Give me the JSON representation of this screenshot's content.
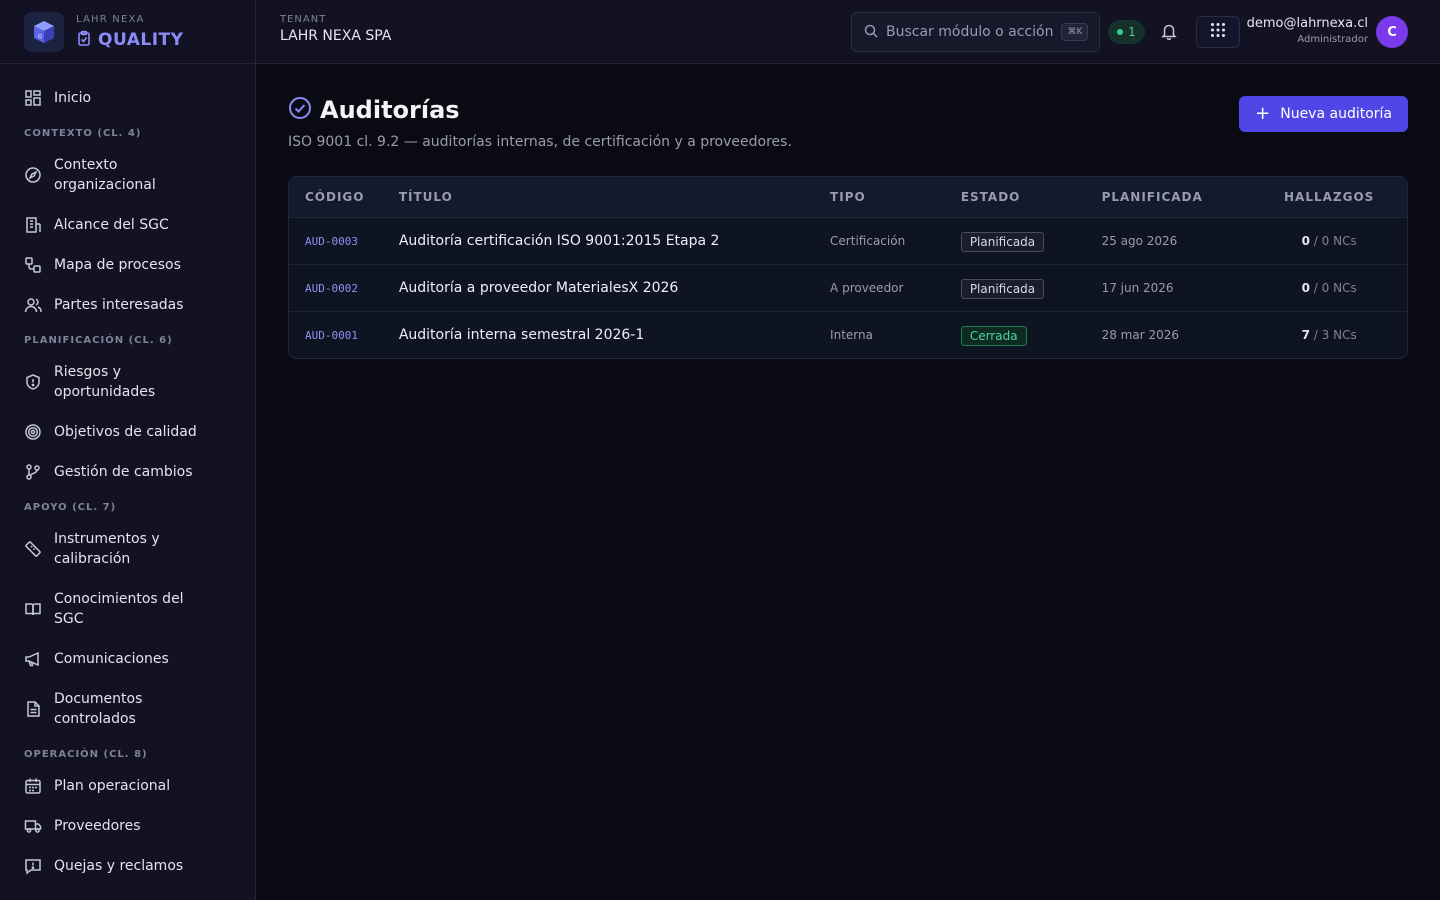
{
  "brand": {
    "small": "LAHR NEXA",
    "name": "QUALITY"
  },
  "nav": {
    "home": "Inicio",
    "sections": [
      {
        "title": "CONTEXTO (CL. 4)",
        "items": [
          "Contexto organizacional",
          "Alcance del SGC",
          "Mapa de procesos",
          "Partes interesadas"
        ]
      },
      {
        "title": "PLANIFICACIÓN (CL. 6)",
        "items": [
          "Riesgos y oportunidades",
          "Objetivos de calidad",
          "Gestión de cambios"
        ]
      },
      {
        "title": "APOYO (CL. 7)",
        "items": [
          "Instrumentos y calibración",
          "Conocimientos del SGC",
          "Comunicaciones",
          "Documentos controlados"
        ]
      },
      {
        "title": "OPERACIÓN (CL. 8)",
        "items": [
          "Plan operacional",
          "Proveedores",
          "Quejas y reclamos"
        ]
      }
    ]
  },
  "header": {
    "tenant_label": "TENANT",
    "tenant_name": "LAHR NEXA SPA",
    "search_placeholder": "Buscar módulo o acción",
    "search_shortcut": "⌘K",
    "online_count": "1",
    "user_email": "demo@lahrnexa.cl",
    "user_role": "Administrador",
    "avatar_initial": "C"
  },
  "page": {
    "title": "Auditorías",
    "subtitle": "ISO 9001 cl. 9.2 — auditorías internas, de certificación y a proveedores.",
    "new_button": "Nueva auditoría"
  },
  "table": {
    "columns": [
      "CÓDIGO",
      "TÍTULO",
      "TIPO",
      "ESTADO",
      "PLANIFICADA",
      "HALLAZGOS"
    ],
    "rows": [
      {
        "code": "AUD-0003",
        "title": "Auditoría certificación ISO 9001:2015 Etapa 2",
        "type": "Certificación",
        "status": "Planificada",
        "planned": "25 ago 2026",
        "findings": "0",
        "ncs": " / 0 NCs"
      },
      {
        "code": "AUD-0002",
        "title": "Auditoría a proveedor MaterialesX 2026",
        "type": "A proveedor",
        "status": "Planificada",
        "planned": "17 jun 2026",
        "findings": "0",
        "ncs": " / 0 NCs"
      },
      {
        "code": "AUD-0001",
        "title": "Auditoría interna semestral 2026-1",
        "type": "Interna",
        "status": "Cerrada",
        "planned": "28 mar 2026",
        "findings": "7",
        "ncs": " / 3 NCs"
      }
    ]
  },
  "colors": {
    "accent": "#4f46e5",
    "brand": "#8b8cf8",
    "success": "#34d399"
  }
}
